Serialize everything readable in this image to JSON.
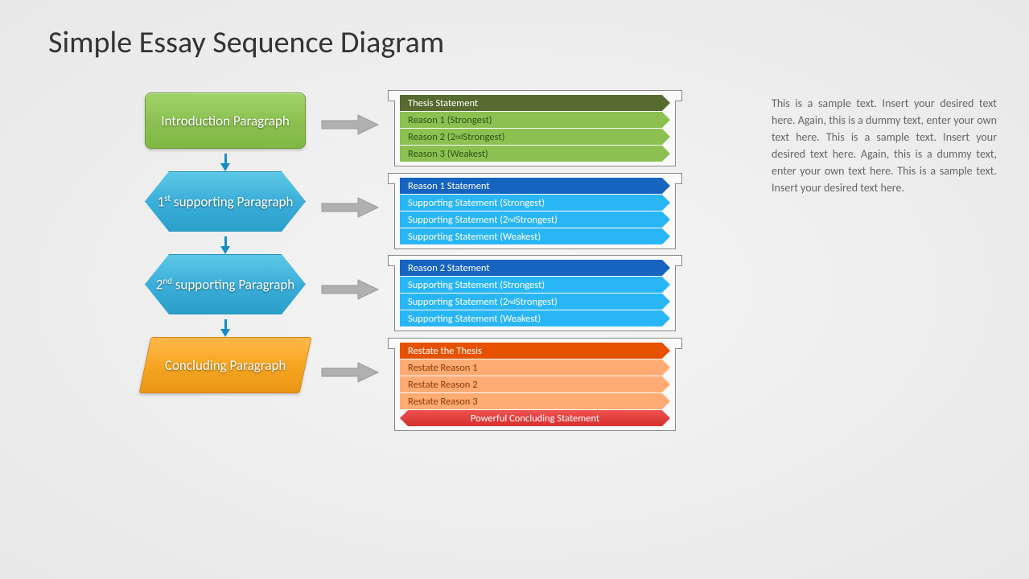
{
  "title": "Simple Essay Sequence Diagram",
  "shapes": {
    "intro": "Introduction Paragraph",
    "sup1_pre": "1",
    "sup1_ord": "st",
    "sup1_post": " supporting Paragraph",
    "sup2_pre": "2",
    "sup2_ord": "nd",
    "sup2_post": " supporting Paragraph",
    "concl": "Concluding Paragraph"
  },
  "boxes": {
    "b1": {
      "h": "Thesis Statement",
      "r1": "Reason 1 (Strongest)",
      "r2a": "Reason 2 (2",
      "r2b": "nd",
      "r2c": " Strongest)",
      "r3": "Reason 3 (Weakest)"
    },
    "b2": {
      "h": "Reason 1 Statement",
      "r1": "Supporting Statement (Strongest)",
      "r2a": "Supporting Statement (2",
      "r2b": "nd",
      "r2c": " Strongest)",
      "r3": "Supporting Statement (Weakest)"
    },
    "b3": {
      "h": "Reason 2 Statement",
      "r1": "Supporting Statement (Strongest)",
      "r2a": "Supporting Statement (2",
      "r2b": "nd",
      "r2c": " Strongest)",
      "r3": "Supporting Statement (Weakest)"
    },
    "b4": {
      "h": "Restate the Thesis",
      "r1": "Restate Reason 1",
      "r2": "Restate Reason 2",
      "r3": "Restate Reason 3",
      "r4": "Powerful Concluding Statement"
    }
  },
  "sidebar": "This is a sample text. Insert your desired text here. Again, this is a dummy text, enter your own text here. This is a sample text. Insert your desired text here. Again, this is a dummy text, enter your own text here. This is a sample text. Insert your desired text here."
}
